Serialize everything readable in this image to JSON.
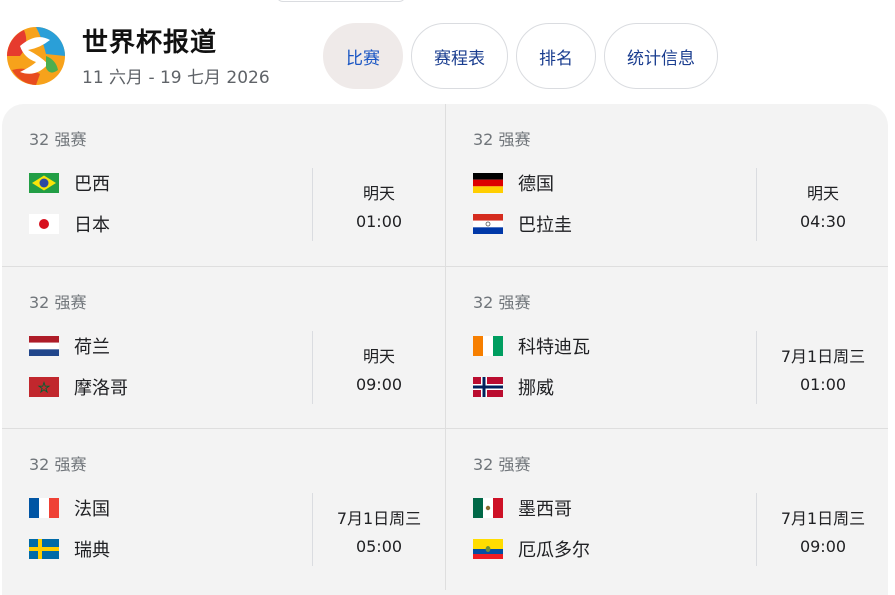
{
  "header": {
    "title": "世界杯报道",
    "subtitle": "11 六月 - 19 七月 2026"
  },
  "tabs": [
    {
      "label": "比赛",
      "active": true
    },
    {
      "label": "赛程表",
      "active": false
    },
    {
      "label": "排名",
      "active": false
    },
    {
      "label": "统计信息",
      "active": false
    }
  ],
  "matches": [
    {
      "stage": "32 强赛",
      "team1": {
        "name": "巴西",
        "flag": "brazil-flag-icon"
      },
      "team2": {
        "name": "日本",
        "flag": "japan-flag-icon"
      },
      "day": "明天",
      "time": "01:00"
    },
    {
      "stage": "32 强赛",
      "team1": {
        "name": "德国",
        "flag": "germany-flag-icon"
      },
      "team2": {
        "name": "巴拉圭",
        "flag": "paraguay-flag-icon"
      },
      "day": "明天",
      "time": "04:30"
    },
    {
      "stage": "32 强赛",
      "team1": {
        "name": "荷兰",
        "flag": "netherlands-flag-icon"
      },
      "team2": {
        "name": "摩洛哥",
        "flag": "morocco-flag-icon"
      },
      "day": "明天",
      "time": "09:00"
    },
    {
      "stage": "32 强赛",
      "team1": {
        "name": "科特迪瓦",
        "flag": "ivory-coast-flag-icon"
      },
      "team2": {
        "name": "挪威",
        "flag": "norway-flag-icon"
      },
      "day": "7月1日周三",
      "time": "01:00"
    },
    {
      "stage": "32 强赛",
      "team1": {
        "name": "法国",
        "flag": "france-flag-icon"
      },
      "team2": {
        "name": "瑞典",
        "flag": "sweden-flag-icon"
      },
      "day": "7月1日周三",
      "time": "05:00"
    },
    {
      "stage": "32 强赛",
      "team1": {
        "name": "墨西哥",
        "flag": "mexico-flag-icon"
      },
      "team2": {
        "name": "厄瓜多尔",
        "flag": "ecuador-flag-icon"
      },
      "day": "7月1日周三",
      "time": "09:00"
    }
  ],
  "colors": {
    "tab_text": "#1a3d8f",
    "tab_active_bg": "#efeae9",
    "panel_bg": "#f3f3f3"
  }
}
